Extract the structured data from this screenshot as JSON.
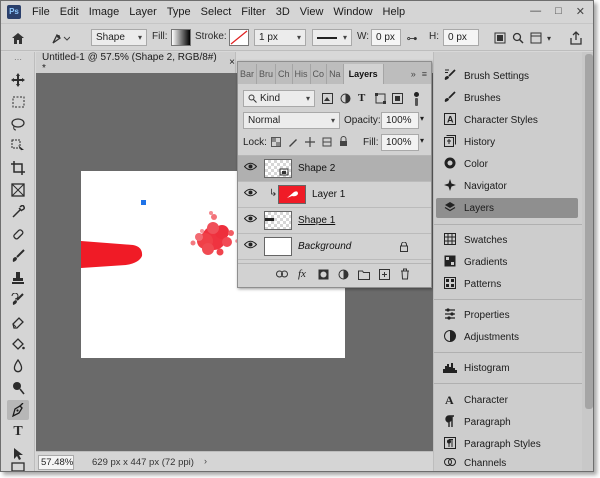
{
  "app": {
    "logo_text": "Ps",
    "menu": [
      "File",
      "Edit",
      "Image",
      "Layer",
      "Type",
      "Select",
      "Filter",
      "3D",
      "View",
      "Window",
      "Help"
    ],
    "window_buttons": [
      "—",
      "□",
      "✕"
    ]
  },
  "options_bar": {
    "mode_label": "Shape",
    "fill_label": "Fill:",
    "stroke_label": "Stroke:",
    "stroke_width": "1 px",
    "w_label": "W:",
    "w_value": "0 px",
    "h_label": "H:",
    "h_value": "0 px"
  },
  "document": {
    "tab_title": "Untitled-1 @ 57.5% (Shape 2, RGB/8#) *",
    "close_glyph": "×",
    "zoom": "57.48%",
    "dimensions": "629 px x 447 px (72 ppi)"
  },
  "layers_panel": {
    "tabs": [
      "Bar",
      "Bru",
      "Ch",
      "His",
      "Co",
      "Na",
      "Layers"
    ],
    "kind_label": "Kind",
    "blend_mode": "Normal",
    "opacity_label": "Opacity:",
    "opacity_value": "100%",
    "lock_label": "Lock:",
    "fill_label": "Fill:",
    "fill_value": "100%",
    "layers": [
      {
        "name": "Shape 2"
      },
      {
        "name": "Layer 1"
      },
      {
        "name": "Shape 1"
      },
      {
        "name": "Background"
      }
    ],
    "footer_fx": "fx"
  },
  "right_panels": {
    "group1": [
      "Brush Settings",
      "Brushes",
      "Character Styles",
      "History",
      "Color",
      "Navigator",
      "Layers"
    ],
    "group2": [
      "Swatches",
      "Gradients",
      "Patterns"
    ],
    "group3": [
      "Properties",
      "Adjustments"
    ],
    "group4": [
      "Histogram"
    ],
    "group5": [
      "Character",
      "Paragraph",
      "Paragraph Styles",
      "Channels"
    ]
  },
  "colors": {
    "red_shape": "#f01b26",
    "selection_blue": "#1e73e8"
  }
}
